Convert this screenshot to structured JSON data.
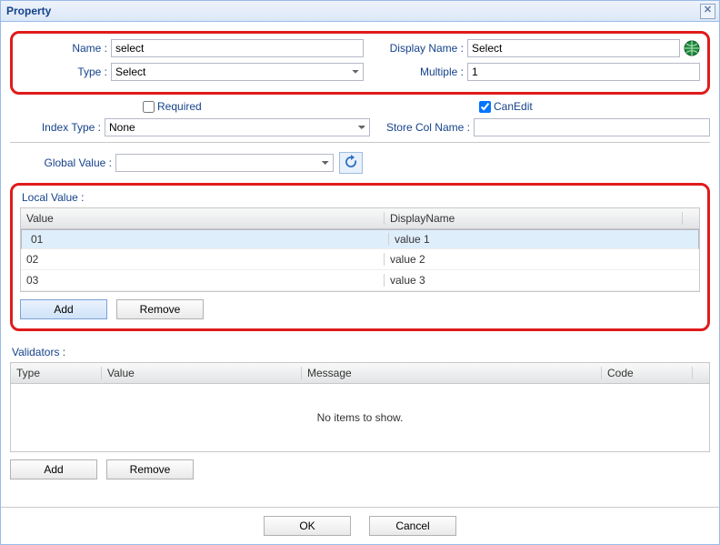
{
  "window": {
    "title": "Property"
  },
  "form": {
    "name_label": "Name :",
    "name_value": "select",
    "display_name_label": "Display Name :",
    "display_name_value": "Select",
    "type_label": "Type :",
    "type_value": "Select",
    "multiple_label": "Multiple :",
    "multiple_value": "1",
    "required_label": "Required",
    "required_checked": false,
    "canedit_label": "CanEdit",
    "canedit_checked": true,
    "index_type_label": "Index Type :",
    "index_type_value": "None",
    "store_col_label": "Store Col Name :",
    "store_col_value": "",
    "global_value_label": "Global Value :",
    "global_value_value": ""
  },
  "localValue": {
    "title": "Local Value :",
    "columns": {
      "value": "Value",
      "display": "DisplayName"
    },
    "rows": [
      {
        "value": "01",
        "display": "value 1",
        "selected": true
      },
      {
        "value": "02",
        "display": "value 2",
        "selected": false
      },
      {
        "value": "03",
        "display": "value 3",
        "selected": false
      }
    ],
    "add": "Add",
    "remove": "Remove"
  },
  "validators": {
    "title": "Validators :",
    "columns": {
      "type": "Type",
      "value": "Value",
      "message": "Message",
      "code": "Code"
    },
    "empty": "No items to show.",
    "add": "Add",
    "remove": "Remove"
  },
  "footer": {
    "ok": "OK",
    "cancel": "Cancel"
  }
}
